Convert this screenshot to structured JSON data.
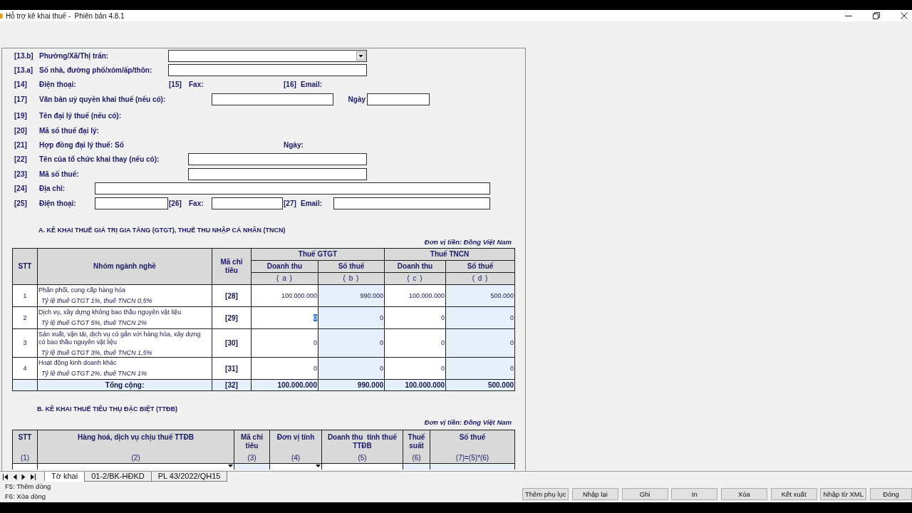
{
  "window": {
    "title": "Hỗ trợ kê khai thuế -  Phiên bản 4.8.1"
  },
  "form": {
    "rows": [
      {
        "items": [
          {
            "kind": "code",
            "text": "[13.b]"
          },
          {
            "kind": "label",
            "text": "Phường/Xã/Thị trấn:"
          },
          {
            "kind": "select"
          }
        ]
      },
      {
        "items": [
          {
            "kind": "code",
            "text": "[13.a]"
          },
          {
            "kind": "label",
            "text": "Số nhà, đường phố/xóm/ấp/thôn:"
          },
          {
            "kind": "input"
          }
        ]
      },
      {
        "items": [
          {
            "kind": "code",
            "text": "[14]"
          },
          {
            "kind": "label",
            "text": "Điện thoại:"
          },
          {
            "kind": "code",
            "text": "[15]"
          },
          {
            "kind": "label",
            "text": "Fax:"
          },
          {
            "kind": "code",
            "text": "[16]"
          },
          {
            "kind": "label",
            "text": "Email:"
          }
        ]
      },
      {
        "items": [
          {
            "kind": "code",
            "text": "[17]"
          },
          {
            "kind": "label",
            "text": "Văn bản uỷ quyền khai thuế (nếu có):"
          },
          {
            "kind": "input"
          },
          {
            "kind": "label",
            "text": "Ngày"
          },
          {
            "kind": "input"
          }
        ]
      },
      {
        "items": [
          {
            "kind": "code",
            "text": "[19]"
          },
          {
            "kind": "label",
            "text": "Tên đại lý thuế (nếu có):"
          }
        ]
      },
      {
        "items": [
          {
            "kind": "code",
            "text": "[20]"
          },
          {
            "kind": "label",
            "text": "Mã số thuế đại lý:"
          }
        ]
      },
      {
        "items": [
          {
            "kind": "code",
            "text": "[21]"
          },
          {
            "kind": "label",
            "text": "Hợp đồng đại lý thuế: Số"
          },
          {
            "kind": "label",
            "text": "Ngày:"
          }
        ]
      },
      {
        "items": [
          {
            "kind": "code",
            "text": "[22]"
          },
          {
            "kind": "label",
            "text": "Tên của tổ chức khai thay (nếu có):"
          },
          {
            "kind": "input"
          }
        ]
      },
      {
        "items": [
          {
            "kind": "code",
            "text": "[23]"
          },
          {
            "kind": "label",
            "text": "Mã số thuế:"
          },
          {
            "kind": "input"
          }
        ]
      },
      {
        "items": [
          {
            "kind": "code",
            "text": "[24]"
          },
          {
            "kind": "label",
            "text": "Địa chỉ:"
          },
          {
            "kind": "input"
          }
        ]
      },
      {
        "items": [
          {
            "kind": "code",
            "text": "[25]"
          },
          {
            "kind": "label",
            "text": "Điện thoại:"
          },
          {
            "kind": "input"
          },
          {
            "kind": "code",
            "text": "[26]"
          },
          {
            "kind": "label",
            "text": "Fax:"
          },
          {
            "kind": "input"
          },
          {
            "kind": "code",
            "text": "[27]"
          },
          {
            "kind": "label",
            "text": "Email:"
          },
          {
            "kind": "input"
          }
        ]
      }
    ]
  },
  "section_a": {
    "title": "A. KÊ KHAI THUẾ GIÁ TRỊ GIA TĂNG (GTGT), THUẾ THU NHẬP CÁ NHÂN (TNCN)",
    "unit": "Đơn vị tiền: Đồng Việt Nam",
    "header": {
      "stt": "STT",
      "group": "Nhóm ngành nghề",
      "code": "Mã chỉ tiêu",
      "gtgt": "Thuế GTGT",
      "tncn": "Thuế TNCN",
      "sub": [
        "Doanh thu",
        "Số thuế",
        "Doanh thu",
        "Số thuế"
      ],
      "letters": [
        "( a )",
        "( b )",
        "( c )",
        "( d )"
      ]
    },
    "rows": [
      {
        "stt": "1",
        "name": "Phân phối, cung cấp hàng hóa",
        "rate": "Tỷ lệ thuế GTGT 1%, thuế TNCN 0,5%",
        "code": "[28]",
        "values": [
          {
            "text": "100.000.000",
            "selected": false
          },
          {
            "text": "990.000",
            "selected": false
          },
          {
            "text": "100.000.000",
            "selected": false
          },
          {
            "text": "500.000",
            "selected": false
          }
        ]
      },
      {
        "stt": "2",
        "name": "Dịch vụ, xây dựng không bao thầu  nguyên vật liệu",
        "rate": "Tỷ lệ thuế GTGT 5%, thuế TNCN 2%",
        "code": "[29]",
        "values": [
          {
            "text": "0",
            "selected": true
          },
          {
            "text": "0",
            "selected": false
          },
          {
            "text": "0",
            "selected": false
          },
          {
            "text": "0",
            "selected": false
          }
        ]
      },
      {
        "stt": "3",
        "name": "Sản xuất, vận tải, dịch vụ có gắn với hàng hóa, xây dựng có bao thầu nguyên vật liệu",
        "rate": "Tỷ lệ thuế GTGT 3%, thuế TNCN 1,5%",
        "code": "[30]",
        "values": [
          {
            "text": "0",
            "selected": false
          },
          {
            "text": "0",
            "selected": false
          },
          {
            "text": "0",
            "selected": false
          },
          {
            "text": "0",
            "selected": false
          }
        ]
      },
      {
        "stt": "4",
        "name": "Hoạt động kinh doanh khác",
        "rate": "Tỷ lệ thuế GTGT 2%, thuế TNCN 1%",
        "code": "[31]",
        "values": [
          {
            "text": "0",
            "selected": false
          },
          {
            "text": "0",
            "selected": false
          },
          {
            "text": "0",
            "selected": false
          },
          {
            "text": "0",
            "selected": false
          }
        ]
      }
    ],
    "total": {
      "label": "Tổng cộng:",
      "code": "[32]",
      "values": [
        "100.000.000",
        "990.000",
        "100.000.000",
        "500.000"
      ]
    }
  },
  "section_b": {
    "title": "B. KÊ KHAI THUẾ TIÊU THỤ ĐẶC BIỆT (TTĐB)",
    "unit": "Đơn vị tiền: Đồng Việt Nam",
    "columns": [
      {
        "title": "STT",
        "number": "(1)"
      },
      {
        "title": "Hàng hoá, dịch vụ chịu thuế TTĐB",
        "number": "(2)"
      },
      {
        "title": "Mã chỉ tiêu",
        "number": "(3)"
      },
      {
        "title": "Đơn vị tính",
        "number": "(4)"
      },
      {
        "title": "Doanh thu  tính thuế TTĐB",
        "number": "(5)"
      },
      {
        "title": "Thuế suất",
        "number": "(6)"
      },
      {
        "title": "Số thuế",
        "number": "(7)=(5)*(6)"
      }
    ]
  },
  "sheet_tabs": [
    {
      "label": "Tờ khai",
      "selected": true
    },
    {
      "label": "01-2/BK-HĐKD",
      "selected": false
    },
    {
      "label": "PL 43/2022/QH15",
      "selected": false
    }
  ],
  "status_hints": [
    "F5: Thêm dòng",
    "F6: Xóa dòng"
  ],
  "buttons": [
    "Thêm phụ lục",
    "Nhập lại",
    "Ghi",
    "In",
    "Xóa",
    "Kết xuất",
    "Nhập từ XML",
    "Đóng"
  ]
}
